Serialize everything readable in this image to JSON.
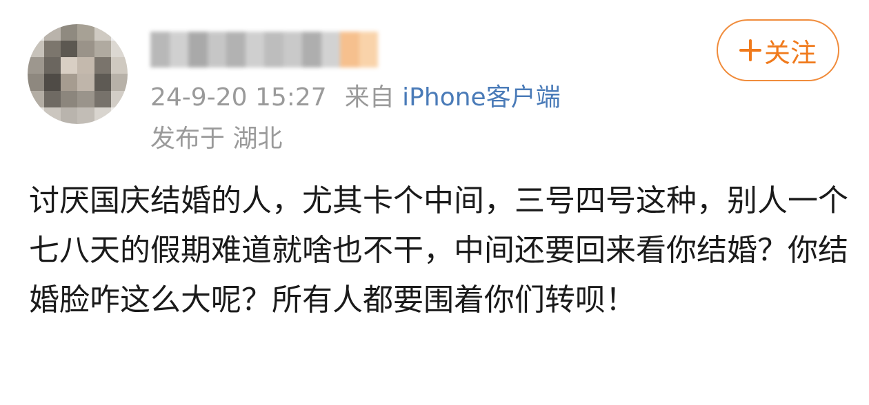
{
  "post": {
    "timestamp": "24-9-20 15:27",
    "source_prefix": "来自",
    "source_client": "iPhone客户端",
    "location": "发布于 湖北",
    "follow_label": "关注",
    "text": "讨厌国庆结婚的人，尤其卡个中间，三号四号这种，别人一个七八天的假期难道就啥也不干，中间还要回来看你结婚？你结婚脸咋这么大呢？所有人都要围着你们转呗！"
  },
  "icons": {
    "follow": "plus-icon"
  },
  "colors": {
    "accent": "#f07a1c",
    "link": "#4a7bb8",
    "meta_text": "#9a9a9a",
    "body_text": "#1a1a1a"
  }
}
